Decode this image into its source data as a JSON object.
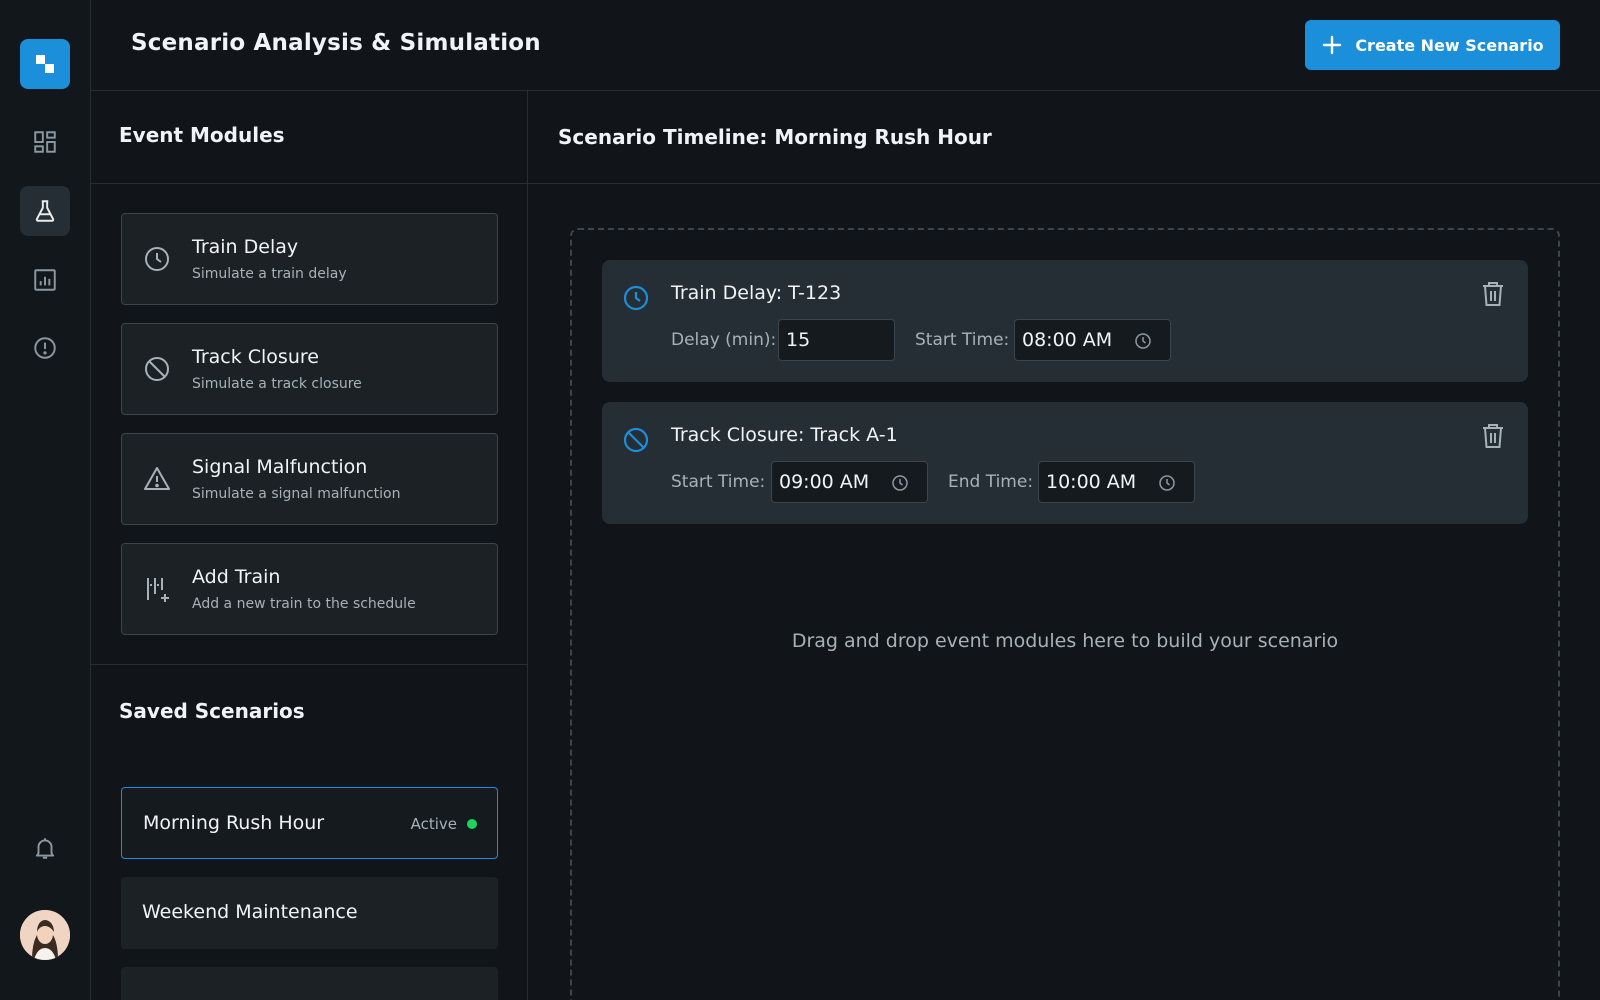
{
  "app": {
    "title": "Scenario Analysis & Simulation",
    "accent_color": "#1b8fd9",
    "create_button_label": "Create New Scenario"
  },
  "rail": {
    "logo_icon": "app-logo-icon",
    "items": [
      {
        "icon": "dashboard-icon",
        "active": false
      },
      {
        "icon": "flask-icon",
        "active": true
      },
      {
        "icon": "report-chart-icon",
        "active": false
      },
      {
        "icon": "alert-circle-icon",
        "active": false
      }
    ],
    "bottom": [
      {
        "icon": "bell-icon"
      },
      {
        "icon": "user-avatar"
      }
    ]
  },
  "event_modules": {
    "heading": "Event Modules",
    "items": [
      {
        "icon": "clock-icon",
        "title": "Train Delay",
        "desc": "Simulate a train delay"
      },
      {
        "icon": "block-icon",
        "title": "Track Closure",
        "desc": "Simulate a track closure"
      },
      {
        "icon": "warning-triangle-icon",
        "title": "Signal Malfunction",
        "desc": "Simulate a signal malfunction"
      },
      {
        "icon": "add-train-icon",
        "title": "Add Train",
        "desc": "Add a new train to the schedule"
      }
    ]
  },
  "saved_scenarios": {
    "heading": "Saved Scenarios",
    "items": [
      {
        "name": "Morning Rush Hour",
        "status": "Active",
        "active": true
      },
      {
        "name": "Weekend Maintenance",
        "status": "",
        "active": false
      }
    ]
  },
  "timeline": {
    "title": "Scenario Timeline: Morning Rush Hour",
    "events": [
      {
        "icon": "clock-icon",
        "title": "Train Delay: T-123",
        "fields": [
          {
            "label": "Delay (min):",
            "value": "15"
          },
          {
            "label": "Start Time:",
            "value": "08:00 AM"
          }
        ]
      },
      {
        "icon": "block-icon",
        "title": "Track Closure: Track A-1",
        "fields": [
          {
            "label": "Start Time:",
            "value": "09:00 AM"
          },
          {
            "label": "End Time:",
            "value": "10:00 AM"
          }
        ]
      }
    ],
    "drop_hint": "Drag and drop event modules here to build your scenario"
  }
}
